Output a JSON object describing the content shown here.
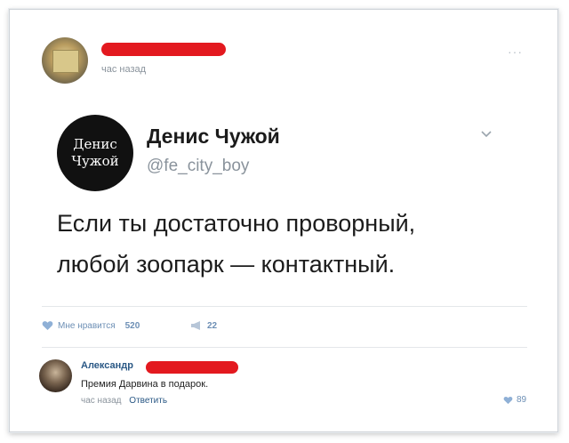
{
  "post": {
    "time": "час назад",
    "menu": "···"
  },
  "tweet": {
    "avatar_line1": "Денис",
    "avatar_line2": "Чужой",
    "name": "Денис Чужой",
    "handle": "@fe_city_boy",
    "text_line1": "Если ты достаточно проворный,",
    "text_line2": "любой зоопарк — контактный."
  },
  "actions": {
    "like_label": "Мне нравится",
    "like_count": "520",
    "share_count": "22"
  },
  "comment": {
    "author": "Александр",
    "text": "Премия Дарвина в подарок.",
    "time": "час назад",
    "reply": "Ответить",
    "likes": "89"
  },
  "colors": {
    "redaction": "#e3191f",
    "link": "#2a5885",
    "action": "#6d8fb5"
  }
}
